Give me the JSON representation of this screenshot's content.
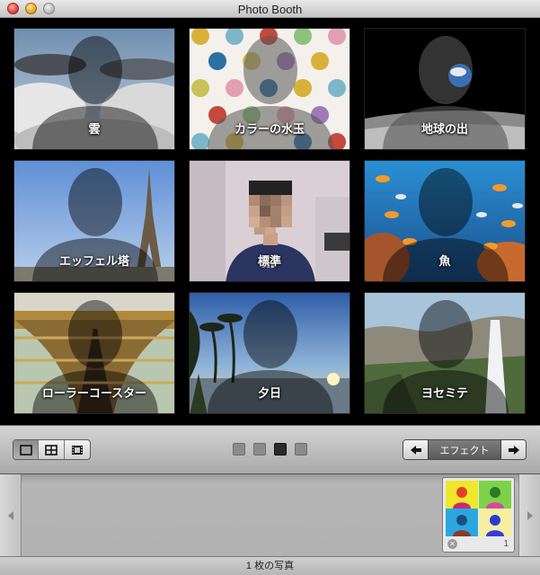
{
  "window": {
    "title": "Photo Booth"
  },
  "effects": [
    {
      "label": "雲"
    },
    {
      "label": "カラーの水玉"
    },
    {
      "label": "地球の出"
    },
    {
      "label": "エッフェル塔"
    },
    {
      "label": "標準"
    },
    {
      "label": "魚"
    },
    {
      "label": "ローラーコースター"
    },
    {
      "label": "夕日"
    },
    {
      "label": "ヨセミテ"
    }
  ],
  "toolbar": {
    "view_modes": [
      "single-view-icon",
      "grid-view-icon",
      "filmstrip-view-icon"
    ],
    "active_view": 0,
    "pages": 4,
    "active_page": 2,
    "effects_label": "エフェクト"
  },
  "strip": {
    "thumbnail_count": "1"
  },
  "status": {
    "text": "1 枚の写真"
  }
}
